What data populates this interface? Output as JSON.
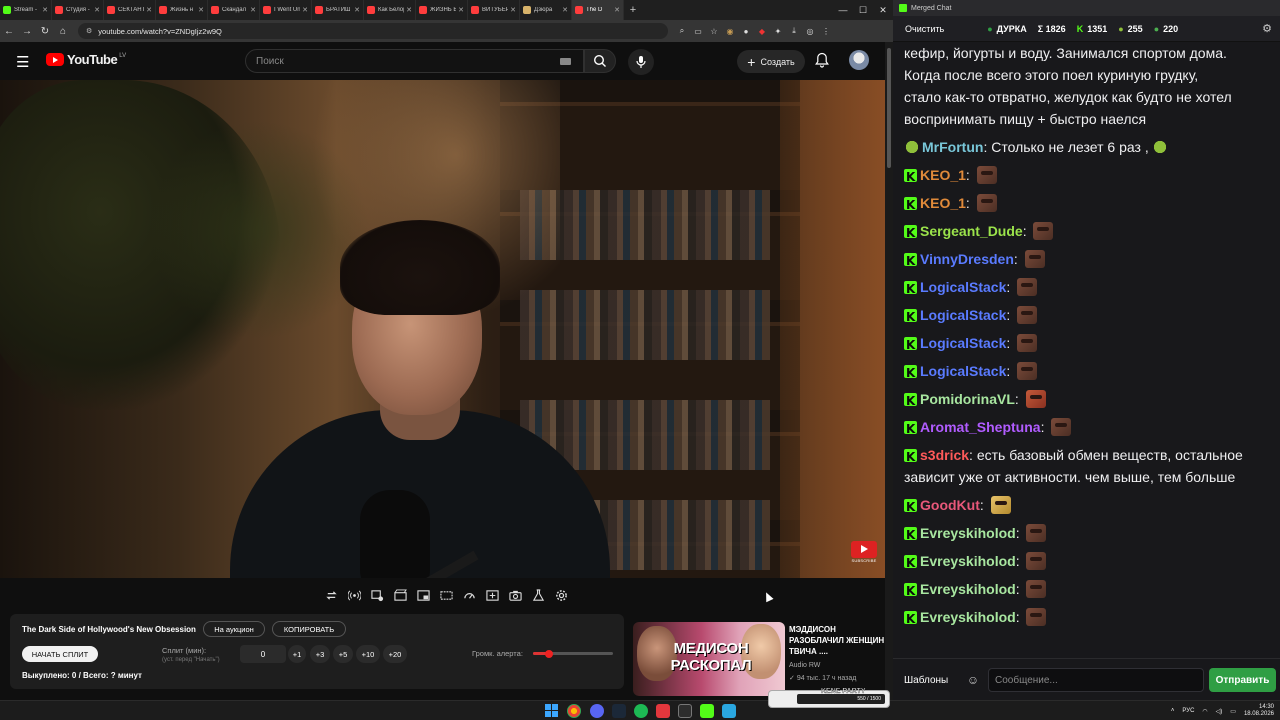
{
  "browser": {
    "tabs": [
      {
        "label": "Stream -",
        "color": "#53fc18",
        "active": false
      },
      {
        "label": "Студия -",
        "color": "#ff3d3d",
        "active": false
      },
      {
        "label": "СЕКТАНТ",
        "color": "#ff3d3d",
        "active": false
      },
      {
        "label": "Жизнь н",
        "color": "#ff3d3d",
        "active": false
      },
      {
        "label": "Скандал",
        "color": "#ff3d3d",
        "active": false
      },
      {
        "label": "I Went Un",
        "color": "#ff3d3d",
        "active": false
      },
      {
        "label": "БРАТИШ",
        "color": "#ff3d3d",
        "active": false
      },
      {
        "label": "Как Белор",
        "color": "#ff3d3d",
        "active": false
      },
      {
        "label": "ЖИЗНЬ В",
        "color": "#ff3d3d",
        "active": false
      },
      {
        "label": "ВИТУБЕР",
        "color": "#ff3d3d",
        "active": false
      },
      {
        "label": "Дзюра",
        "color": "#d8b36a",
        "active": false
      },
      {
        "label": "The D",
        "color": "#ff3d3d",
        "active": true
      }
    ],
    "url": "youtube.com/watch?v=ZNDgIjz2w9Q"
  },
  "youtube": {
    "logo_text": "YouTube",
    "country_code": "LV",
    "search_placeholder": "Поиск",
    "create_label": "Создать",
    "subscribe_watermark": "SUBSCRIBE"
  },
  "split_panel": {
    "video_title": "The Dark Side of Hollywood's New Obsession",
    "auction_label": "На аукцион",
    "copy_label": "КОПИРОВАТЬ",
    "start_split_label": "НАЧАТЬ СПЛИТ",
    "split_label": "Сплит (мин):",
    "split_hint": "(уст. перед \"Начать\")",
    "split_value": "0",
    "increments": [
      "+1",
      "+3",
      "+5",
      "+10",
      "+20"
    ],
    "alert_volume_label": "Громк. алерта:",
    "alert_volume_level": 0.2,
    "bought_line": "Выкуплено: 0 / Всего: ? минут"
  },
  "recommended": {
    "thumb_caption": "МЕДИСОН РАСКОПАЛ",
    "title": "МЭДДИСОН РАЗОБЛАЧИЛ ЖЕНЩИН ТВИЧА ....",
    "channel": "Audio RW",
    "meta": "94 тыс.  17 ч назад"
  },
  "chat": {
    "window_title": "Merged Chat",
    "clear_label": "Очистить",
    "stats": [
      {
        "icon": "live-dot-icon",
        "value": "ДУРКА",
        "color": "#2f9e44"
      },
      {
        "icon": "sigma-icon",
        "value": "Σ 1826",
        "color": "#ffffff"
      },
      {
        "icon": "kick-icon",
        "value": "1351",
        "color": "#53fc18"
      },
      {
        "icon": "pepe-icon",
        "value": "255",
        "color": "#8fbf3a"
      },
      {
        "icon": "frog-icon",
        "value": "220",
        "color": "#4caf50"
      }
    ],
    "first_message_lines": [
      "кефир, йогурты и воду. Занимался спортом дома.",
      "Когда после всего этого поел куриную грудку,",
      "стало как-то отвратно, желудок как будто не хотел",
      "воспринимать пищу + быстро наелся"
    ],
    "messages": [
      {
        "user": "MrFortun",
        "color": "#79c7d9",
        "text": "Столько не лезет 6 раз ,",
        "badge": "pepe",
        "emote": "pepe"
      },
      {
        "user": "KEO_1",
        "color": "#e08a3a",
        "text": "",
        "badge": "kick",
        "emote": "brown"
      },
      {
        "user": "KEO_1",
        "color": "#e08a3a",
        "text": "",
        "badge": "kick",
        "emote": "brown"
      },
      {
        "user": "Sergeant_Dude",
        "color": "#9be34b",
        "text": "",
        "badge": "kick",
        "emote": "brown"
      },
      {
        "user": "VinnyDresden",
        "color": "#5a7bff",
        "text": "",
        "badge": "kick",
        "emote": "brown"
      },
      {
        "user": "LogicalStack",
        "color": "#5a7bff",
        "text": "",
        "badge": "kick",
        "emote": "brown"
      },
      {
        "user": "LogicalStack",
        "color": "#5a7bff",
        "text": "",
        "badge": "kick",
        "emote": "brown"
      },
      {
        "user": "LogicalStack",
        "color": "#5a7bff",
        "text": "",
        "badge": "kick",
        "emote": "brown"
      },
      {
        "user": "LogicalStack",
        "color": "#5a7bff",
        "text": "",
        "badge": "kick",
        "emote": "brown"
      },
      {
        "user": "PomidorinaVL",
        "color": "#a8e6a0",
        "text": "",
        "badge": "kick",
        "emote": "red"
      },
      {
        "user": "Aromat_Sheptuna",
        "color": "#b15cff",
        "text": "",
        "badge": "kick",
        "emote": "brown"
      },
      {
        "user": "s3drick",
        "color": "#ff5a5a",
        "text": "есть базовый обмен веществ, остальное зависит уже от активности. чем выше, тем больше",
        "badge": "kick",
        "emote": ""
      },
      {
        "user": "GoodKut",
        "color": "#e8587a",
        "text": "",
        "badge": "kick",
        "emote": "gold"
      },
      {
        "user": "Evreyskiholod",
        "color": "#a8e6a0",
        "text": "",
        "badge": "kick",
        "emote": "brown"
      },
      {
        "user": "Evreyskiholod",
        "color": "#a8e6a0",
        "text": "",
        "badge": "kick",
        "emote": "brown"
      },
      {
        "user": "Evreyskiholod",
        "color": "#a8e6a0",
        "text": "",
        "badge": "kick",
        "emote": "brown"
      },
      {
        "user": "Evreyskiholod",
        "color": "#a8e6a0",
        "text": "",
        "badge": "kick",
        "emote": "brown"
      }
    ],
    "templates_label": "Шаблоны",
    "input_placeholder": "Сообщение...",
    "send_label": "Отправить"
  },
  "taskbar": {
    "kene_label": "KENE PARTY",
    "kene_progress": "550 / 1500",
    "lang": "РУС",
    "time": "14:30",
    "date": "18.08.2026"
  }
}
